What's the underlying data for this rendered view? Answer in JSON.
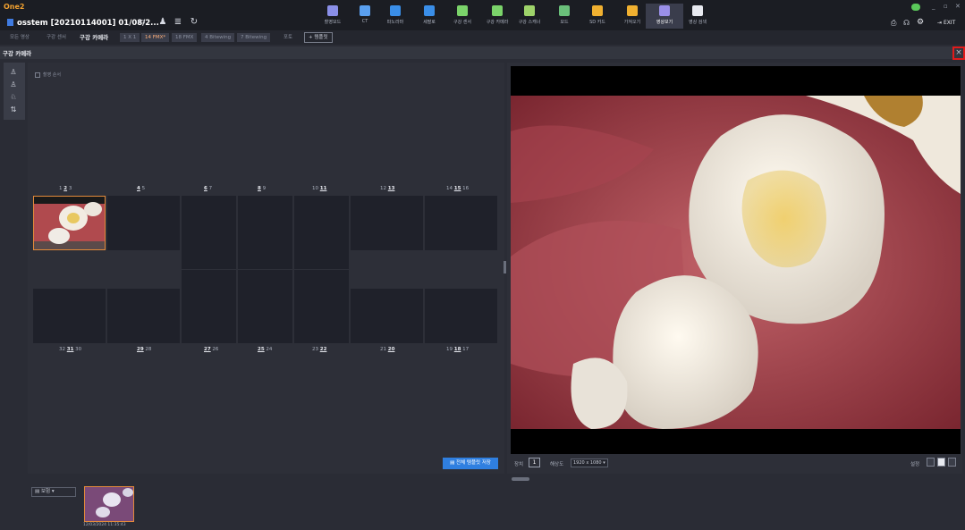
{
  "app": {
    "logo": "One2",
    "patient_label": "osstem [20210114001] 01/08/2...",
    "exit_label": "EXIT"
  },
  "modules": [
    {
      "label": "촬영모드",
      "icon": "capture-icon",
      "color": "#8a8fe8"
    },
    {
      "label": "CT",
      "icon": "ct-icon",
      "color": "#5aa0f0"
    },
    {
      "label": "파노라마",
      "icon": "panorama-icon",
      "color": "#3a8ee8"
    },
    {
      "label": "세팔로",
      "icon": "cephalo-icon",
      "color": "#3a8ee8"
    },
    {
      "label": "구강 센서",
      "icon": "sensor-icon",
      "color": "#7bd36a"
    },
    {
      "label": "구강 카메라",
      "icon": "intraoral-camera-icon",
      "color": "#7bd36a"
    },
    {
      "label": "구강 스캐너",
      "icon": "scanner-icon",
      "color": "#9ed36a"
    },
    {
      "label": "모드",
      "icon": "mode-icon",
      "color": "#6ac07a"
    },
    {
      "label": "SD 카드",
      "icon": "sd-card-icon",
      "color": "#f0b030"
    },
    {
      "label": "가져오기",
      "icon": "import-icon",
      "color": "#f0b030"
    },
    {
      "label": "영상보기",
      "icon": "image-view-icon",
      "color": "#9a8fe8",
      "active": true
    },
    {
      "label": "영상 검색",
      "icon": "search-icon",
      "color": "#e8eaf0"
    }
  ],
  "subtabs": {
    "all": "모든 영상",
    "sensor": "구강 센서",
    "camera": "구강 카메라",
    "templates": [
      "1 X 1",
      "14 FMX*",
      "18 FMX",
      "4 Bitewing",
      "7 Bitewing"
    ],
    "photo": "포토",
    "add": "+ 템플릿"
  },
  "section_title": "구강 카메라",
  "panel": {
    "checkbox_label": "촬영 순서",
    "upper_numbers": [
      {
        "text": "1",
        "bold": "2",
        "after": "3"
      },
      {
        "text": "",
        "bold": "4",
        "after": "5"
      },
      {
        "text": "",
        "bold": "6",
        "after": "7"
      },
      {
        "text": "",
        "bold": "8",
        "after": "9"
      },
      {
        "text": "10",
        "bold": "11",
        "after": ""
      },
      {
        "text": "12",
        "bold": "13",
        "after": ""
      },
      {
        "text": "14",
        "bold": "15",
        "after": "16"
      }
    ],
    "lower_numbers": [
      {
        "text": "32",
        "bold": "31",
        "after": "30"
      },
      {
        "text": "",
        "bold": "29",
        "after": "28"
      },
      {
        "text": "",
        "bold": "27",
        "after": "26"
      },
      {
        "text": "",
        "bold": "25",
        "after": "24"
      },
      {
        "text": "23",
        "bold": "22",
        "after": ""
      },
      {
        "text": "21",
        "bold": "20",
        "after": ""
      },
      {
        "text": "19",
        "bold": "18",
        "after": "17"
      }
    ],
    "mount_button": "전체 템플릿 저장"
  },
  "viewer": {
    "count_label": "장치",
    "count_value": "1",
    "resolution_label": "해상도",
    "resolution_value": "1920 x 1080",
    "display_label": "설정"
  },
  "bottom": {
    "filter_value": "보험",
    "thumb_date": "12/03/2024 11:35:43"
  }
}
